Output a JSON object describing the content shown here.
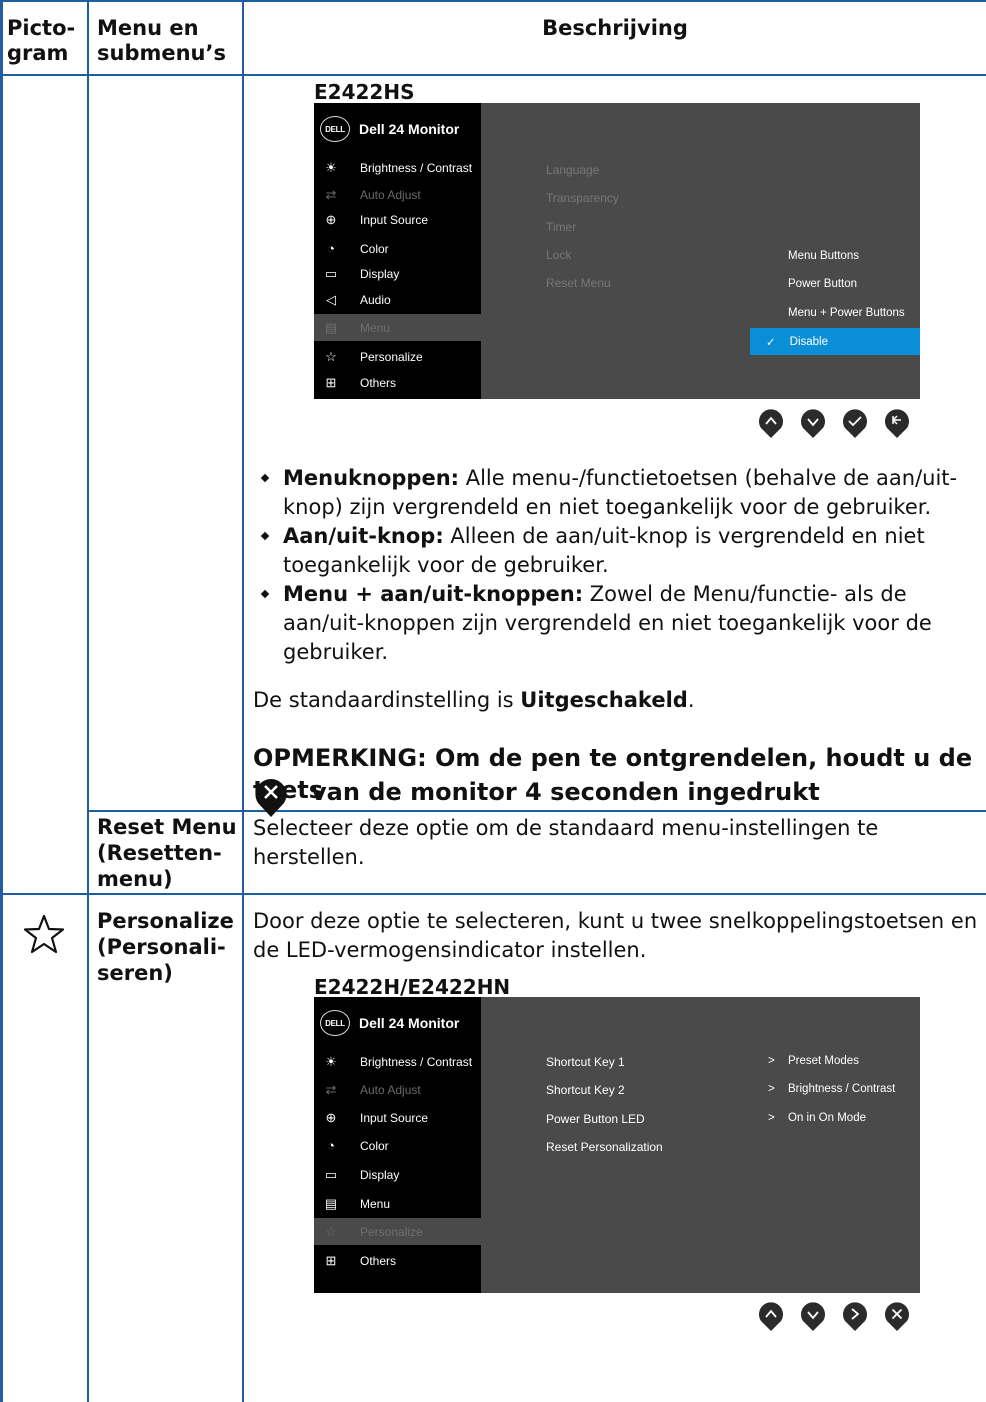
{
  "header": {
    "col1": "Picto-\ngram",
    "col2": "Menu en\nsubmenu’s",
    "col3": "Beschrijving"
  },
  "lock_section": {
    "model": "E2422HS",
    "osd": {
      "title": "Dell 24 Monitor",
      "logo": "DELL",
      "menu": [
        {
          "icon": "brightness-icon",
          "label": "Brightness / Contrast"
        },
        {
          "icon": "auto-adjust-icon",
          "label": "Auto Adjust"
        },
        {
          "icon": "input-source-icon",
          "label": "Input Source"
        },
        {
          "icon": "color-icon",
          "label": "Color"
        },
        {
          "icon": "display-icon",
          "label": "Display"
        },
        {
          "icon": "audio-icon",
          "label": "Audio"
        },
        {
          "icon": "menu-icon",
          "label": "Menu"
        },
        {
          "icon": "star-icon",
          "label": "Personalize"
        },
        {
          "icon": "others-icon",
          "label": "Others"
        }
      ],
      "options": [
        "Language",
        "Transparency",
        "Timer",
        "Lock",
        "Reset Menu"
      ],
      "submenu": [
        "Menu Buttons",
        "Power Button",
        "Menu + Power Buttons"
      ],
      "submenu_selected": "Disable",
      "check": "✓"
    },
    "buttons": [
      "up-icon",
      "down-icon",
      "check-icon",
      "back-icon"
    ],
    "bullets": [
      {
        "bold": "Menuknoppen:",
        "text": " Alle menu-/functietoetsen (behalve de aan/uit-knop) zijn vergrendeld en niet toegankelijk voor de gebruiker."
      },
      {
        "bold": "Aan/uit-knop:",
        "text": " Alleen de aan/uit-knop is vergrendeld en niet toegankelijk voor de gebruiker."
      },
      {
        "bold": "Menu + aan/uit-knoppen:",
        "text": " Zowel de Menu/functie- als de aan/uit-knoppen zijn vergrendeld en niet toegankelijk voor de gebruiker."
      }
    ],
    "default_prefix": "De standaardinstelling is ",
    "default_value": "Uitgeschakeld",
    "default_suffix": ".",
    "note_line1": "OPMERKING: Om de pen te ontgrendelen, houdt u de toets",
    "note_line2": "van de monitor 4 seconden ingedrukt"
  },
  "reset_menu": {
    "name": "Reset Menu\n(Resetten-\nmenu)",
    "description": "Selecteer deze optie om de standaard menu-instellingen te herstellen."
  },
  "personalize": {
    "name": "Personalize\n(Personali-\nseren)",
    "description": "Door deze optie te selecteren, kunt u twee snelkoppelingstoetsen en de LED-vermogensindicator instellen.",
    "model": "E2422H/E2422HN",
    "osd": {
      "title": "Dell 24 Monitor",
      "logo": "DELL",
      "menu": [
        {
          "icon": "brightness-icon",
          "label": "Brightness / Contrast"
        },
        {
          "icon": "auto-adjust-icon",
          "label": "Auto Adjust"
        },
        {
          "icon": "input-source-icon",
          "label": "Input Source"
        },
        {
          "icon": "color-icon",
          "label": "Color"
        },
        {
          "icon": "display-icon",
          "label": "Display"
        },
        {
          "icon": "menu-icon",
          "label": "Menu"
        },
        {
          "icon": "star-icon",
          "label": "Personalize"
        },
        {
          "icon": "others-icon",
          "label": "Others"
        }
      ],
      "options": [
        "Shortcut Key 1",
        "Shortcut Key 2",
        "Power Button LED",
        "Reset Personalization"
      ],
      "arrow": ">",
      "values": [
        "Preset Modes",
        "Brightness / Contrast",
        "On in On Mode"
      ]
    },
    "buttons": [
      "up-icon",
      "down-icon",
      "right-icon",
      "close-icon"
    ]
  }
}
